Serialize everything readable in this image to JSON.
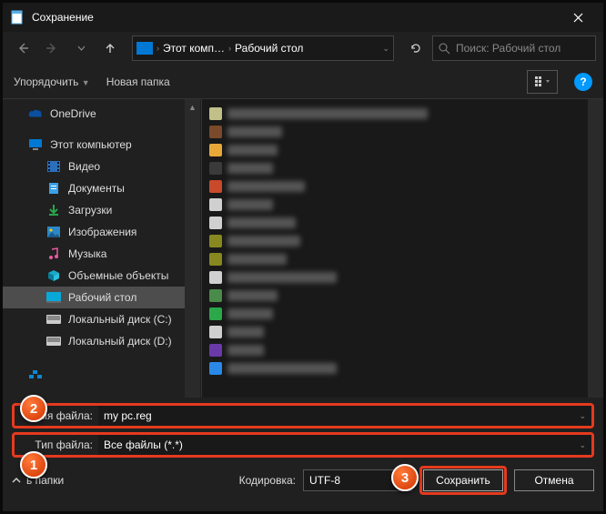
{
  "titlebar": {
    "title": "Сохранение"
  },
  "nav": {
    "breadcrumb_root": "Этот комп…",
    "breadcrumb_leaf": "Рабочий стол",
    "search_placeholder": "Поиск: Рабочий стол"
  },
  "toolbar": {
    "organize": "Упорядочить",
    "new_folder": "Новая папка"
  },
  "sidebar": {
    "onedrive": "OneDrive",
    "this_pc": "Этот компьютер",
    "items": [
      {
        "label": "Видео"
      },
      {
        "label": "Документы"
      },
      {
        "label": "Загрузки"
      },
      {
        "label": "Изображения"
      },
      {
        "label": "Музыка"
      },
      {
        "label": "Объемные объекты"
      },
      {
        "label": "Рабочий стол"
      },
      {
        "label": "Локальный диск (C:)"
      },
      {
        "label": "Локальный диск (D:)"
      }
    ]
  },
  "fields": {
    "filename_label": "Имя файла:",
    "filename_value": "my pc.reg",
    "filetype_label": "Тип файла:",
    "filetype_value": "Все файлы  (*.*)"
  },
  "footer": {
    "hide_folders": "ь папки",
    "encoding_label": "Кодировка:",
    "encoding_value": "UTF-8",
    "save": "Сохранить",
    "cancel": "Отмена"
  },
  "markers": {
    "one": "1",
    "two": "2",
    "three": "3"
  }
}
